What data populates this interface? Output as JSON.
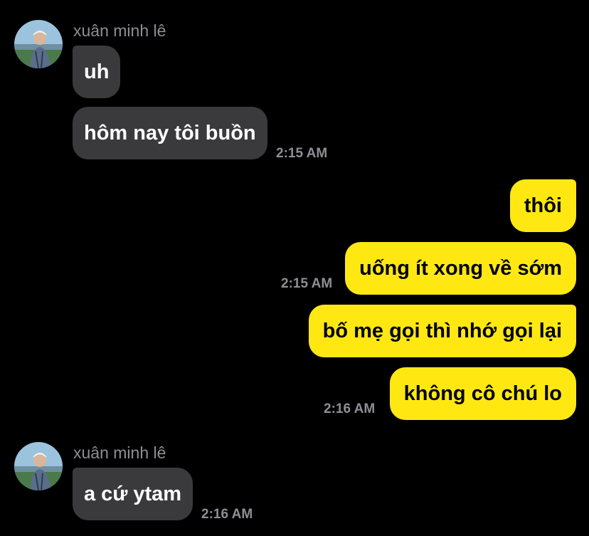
{
  "colors": {
    "background": "#000000",
    "incoming_bubble": "#3a3a3c",
    "outgoing_bubble": "#ffe812",
    "meta_text": "#8e8e93"
  },
  "groups": [
    {
      "sender": "xuân minh lê",
      "avatar_icon": "profile-photo-avatar",
      "messages": [
        "uh",
        "hôm nay tôi buồn"
      ],
      "time": "2:15 AM"
    },
    {
      "outgoing": true,
      "messages": [
        "thôi",
        "uống ít xong về sớm"
      ],
      "time": "2:15 AM"
    },
    {
      "outgoing": true,
      "messages": [
        "bố mẹ gọi thì nhớ gọi lại",
        "không cô chú lo"
      ],
      "time": "2:16 AM"
    },
    {
      "sender": "xuân minh lê",
      "avatar_icon": "profile-photo-avatar",
      "messages": [
        "a cứ ytam"
      ],
      "time": "2:16 AM"
    }
  ]
}
